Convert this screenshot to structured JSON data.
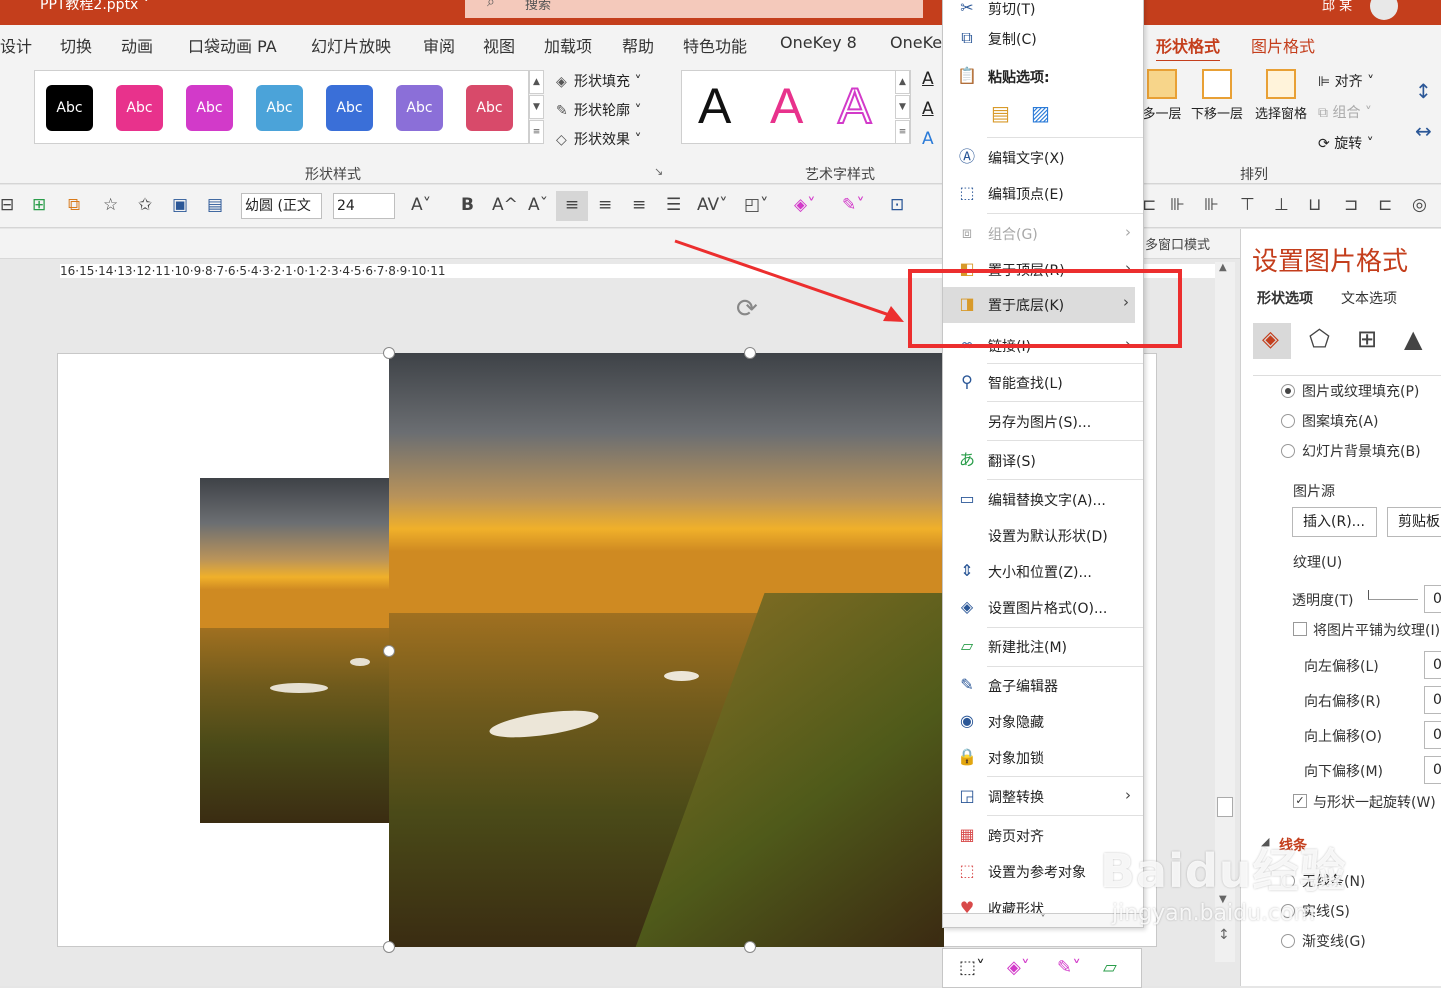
{
  "titlebar": {
    "filename": "PPT教程2.pptx ˅",
    "search_placeholder": "搜索",
    "user": "邱 某"
  },
  "tabs": [
    {
      "label": "设计"
    },
    {
      "label": "切换"
    },
    {
      "label": "动画"
    },
    {
      "label": "口袋动画 PA"
    },
    {
      "label": "幻灯片放映"
    },
    {
      "label": "审阅"
    },
    {
      "label": "视图"
    },
    {
      "label": "加载项"
    },
    {
      "label": "帮助"
    },
    {
      "label": "特色功能"
    },
    {
      "label": "OneKey 8"
    },
    {
      "label": "OneKe"
    },
    {
      "label": "形状格式"
    },
    {
      "label": "图片格式"
    }
  ],
  "ribbon": {
    "shape_styles": {
      "swatch_label": "Abc",
      "colors": [
        "#000000",
        "#e8328c",
        "#d23ac9",
        "#4ba3d9",
        "#3a6fd8",
        "#8b6fd8",
        "#d84a6a"
      ],
      "fill": "形状填充 ˅",
      "outline": "形状轮廓 ˅",
      "effects": "形状效果 ˅",
      "group_label": "形状样式"
    },
    "wordart": {
      "letter": "A",
      "group_label": "艺术字样式"
    },
    "arrange": {
      "bring_forward": "多一层",
      "send_backward": "下移一层",
      "selection_pane": "选择窗格",
      "align": "对齐 ˅",
      "group": "组合 ˅",
      "rotate": "旋转 ˅",
      "group_label": "排列"
    }
  },
  "toolbar2": {
    "font_name": "幼圆 (正文",
    "font_size": "24"
  },
  "statusline": {
    "multiwindow": "多窗口模式"
  },
  "ruler": {
    "text": "16·15·14·13·12·11·10·9·8·7·6·5·4·3·2·1·0·1·2·3·4·5·6·7·8·9·10·11"
  },
  "context_menu": {
    "items": [
      {
        "label": "剪切(T)",
        "icon": "scissors-icon",
        "disabled": false,
        "submenu": false
      },
      {
        "label": "复制(C)",
        "icon": "copy-icon",
        "disabled": false,
        "submenu": false
      },
      {
        "label": "粘贴选项:",
        "icon": "paste-icon",
        "disabled": false,
        "submenu": false
      },
      {
        "label": "编辑文字(X)",
        "icon": "edit-text-icon",
        "disabled": false,
        "submenu": false
      },
      {
        "label": "编辑顶点(E)",
        "icon": "edit-points-icon",
        "disabled": false,
        "submenu": false
      },
      {
        "label": "组合(G)",
        "icon": "group-icon",
        "disabled": true,
        "submenu": true
      },
      {
        "label": "置于顶层(R)",
        "icon": "bring-to-front-icon",
        "disabled": false,
        "submenu": true
      },
      {
        "label": "置于底层(K)",
        "icon": "send-to-back-icon",
        "disabled": false,
        "submenu": true
      },
      {
        "label": "链接(I)",
        "icon": "link-icon",
        "disabled": false,
        "submenu": true
      },
      {
        "label": "智能查找(L)",
        "icon": "smart-lookup-icon",
        "disabled": false,
        "submenu": false
      },
      {
        "label": "另存为图片(S)...",
        "icon": "",
        "disabled": false,
        "submenu": false
      },
      {
        "label": "翻译(S)",
        "icon": "translate-icon",
        "disabled": false,
        "submenu": false
      },
      {
        "label": "编辑替换文字(A)...",
        "icon": "alt-text-icon",
        "disabled": false,
        "submenu": false
      },
      {
        "label": "设置为默认形状(D)",
        "icon": "",
        "disabled": false,
        "submenu": false
      },
      {
        "label": "大小和位置(Z)...",
        "icon": "size-position-icon",
        "disabled": false,
        "submenu": false
      },
      {
        "label": "设置图片格式(O)...",
        "icon": "format-picture-icon",
        "disabled": false,
        "submenu": false
      },
      {
        "label": "新建批注(M)",
        "icon": "new-comment-icon",
        "disabled": false,
        "submenu": false
      },
      {
        "label": "盒子编辑器",
        "icon": "box-editor-icon",
        "disabled": false,
        "submenu": false
      },
      {
        "label": "对象隐藏",
        "icon": "hide-object-icon",
        "disabled": false,
        "submenu": false
      },
      {
        "label": "对象加锁",
        "icon": "lock-icon",
        "disabled": false,
        "submenu": false
      },
      {
        "label": "调整转换",
        "icon": "adjust-convert-icon",
        "disabled": false,
        "submenu": true
      },
      {
        "label": "跨页对齐",
        "icon": "cross-page-align-icon",
        "disabled": false,
        "submenu": false
      },
      {
        "label": "设置为参考对象",
        "icon": "reference-object-icon",
        "disabled": false,
        "submenu": false
      },
      {
        "label": "收藏形状",
        "icon": "favorite-shape-icon",
        "disabled": false,
        "submenu": false
      }
    ]
  },
  "pane": {
    "title": "设置图片格式",
    "tab_shape": "形状选项",
    "tab_text": "文本选项",
    "fill_picture": "图片或纹理填充(P)",
    "fill_pattern": "图案填充(A)",
    "fill_slide_bg": "幻灯片背景填充(B)",
    "picture_source": "图片源",
    "insert": "插入(R)...",
    "clipboard": "剪贴板",
    "texture": "纹理(U)",
    "transparency": "透明度(T)",
    "tile": "将图片平铺为纹理(I)",
    "offset_left": "向左偏移(L)",
    "offset_right": "向右偏移(R)",
    "offset_up": "向上偏移(O)",
    "offset_down": "向下偏移(M)",
    "rotate_with_shape": "与形状一起旋转(W)",
    "line_section": "线条",
    "no_line": "无线条(N)",
    "solid_line": "实线(S)",
    "gradient_line": "渐变线(G)",
    "zero": "0"
  },
  "watermark": {
    "brand": "Baidu经验",
    "url": "jingyan.baidu.com"
  },
  "colors": {
    "accent": "#c43e1c",
    "annotation": "#ec2e2e"
  }
}
